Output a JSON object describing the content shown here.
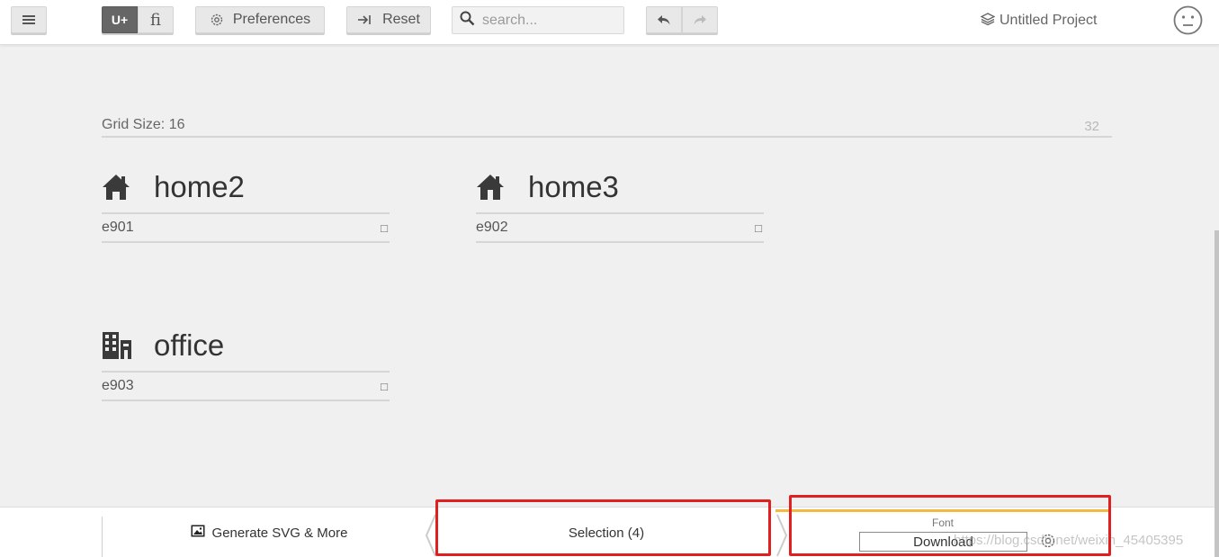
{
  "topbar": {
    "menu_icon": "hamburger-icon",
    "unicode_mode_label": "U+",
    "ligature_mode_label": "fi",
    "preferences_label": "Preferences",
    "preferences_icon": "gear-icon",
    "reset_label": "Reset",
    "reset_icon": "tab-arrow-icon",
    "search_placeholder": "search...",
    "search_icon": "search-icon",
    "undo_icon": "undo-icon",
    "redo_icon": "redo-icon",
    "project_icon": "layers-icon",
    "project_name": "Untitled Project",
    "avatar_icon": "neutral-face-icon"
  },
  "grid": {
    "label": "Grid Size: 16",
    "max": "32"
  },
  "glyphs": [
    {
      "name": "home2",
      "code": "e901",
      "icon": "home-icon"
    },
    {
      "name": "home3",
      "code": "e902",
      "icon": "home-icon"
    },
    {
      "name": "office",
      "code": "e903",
      "icon": "office-icon"
    }
  ],
  "code_box_glyph": "□",
  "bottombar": {
    "generate_label": "Generate SVG & More",
    "generate_icon": "image-icon",
    "selection_label": "Selection (4)",
    "font_label": "Font",
    "download_label": "Download",
    "settings_icon": "gear-icon",
    "watermark": "https://blog.csdn.net/weixin_45405395"
  },
  "colors": {
    "accent_bar": "#f5b942",
    "highlight_box": "#e02020",
    "active_segment": "#666666"
  }
}
